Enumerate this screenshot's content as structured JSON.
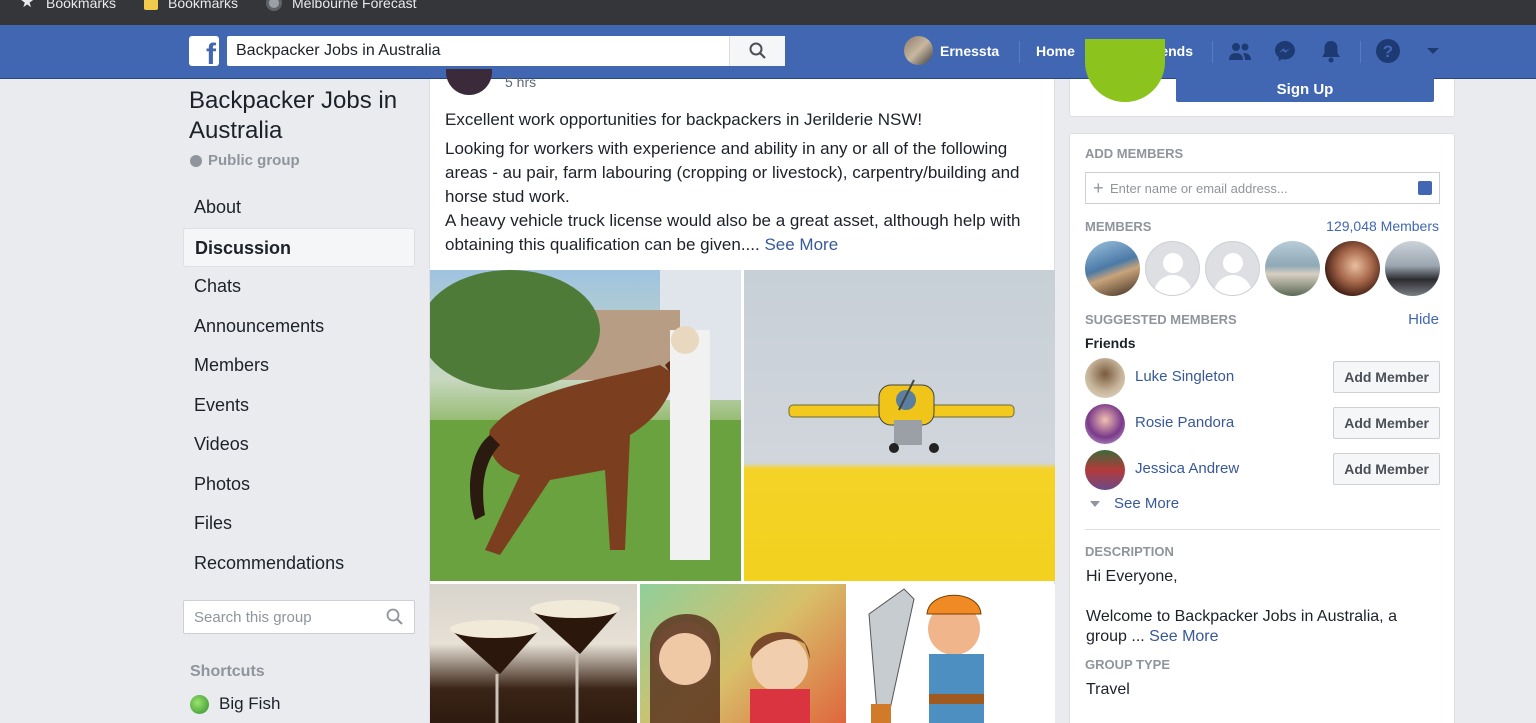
{
  "bookmarks_bar": {
    "items": [
      {
        "label": "Bookmarks",
        "icon": "star-icon"
      },
      {
        "label": "Bookmarks",
        "icon": "folder-icon"
      },
      {
        "label": "Melbourne Forecast",
        "icon": "gear-icon"
      }
    ]
  },
  "header": {
    "search_value": "Backpacker Jobs in Australia",
    "profile_name": "Ernessta",
    "home_label": "Home",
    "find_friends_label": "Find Friends"
  },
  "left": {
    "group_title": "Backpacker Jobs in Australia",
    "privacy": "Public group",
    "nav": [
      "About",
      "Discussion",
      "Chats",
      "Announcements",
      "Members",
      "Events",
      "Videos",
      "Photos",
      "Files",
      "Recommendations"
    ],
    "active_nav": "Discussion",
    "search_placeholder": "Search this group",
    "shortcuts_heading": "Shortcuts",
    "shortcut_item": "Big Fish"
  },
  "post": {
    "time": "5 hrs",
    "line1": "Excellent work opportunities for backpackers in Jerilderie NSW!",
    "body": "Looking for workers with experience and ability in any or all of the following areas - au pair, farm labouring (cropping or livestock), carpentry/building and horse stud work.",
    "body2": "A heavy vehicle truck license would also be a great asset, although help with obtaining this qualification can be given....",
    "see_more": "See More"
  },
  "right": {
    "signup_label": "Sign Up",
    "add_members_heading": "ADD MEMBERS",
    "add_members_placeholder": "Enter name or email address...",
    "members_heading": "MEMBERS",
    "members_count": "129,048 Members",
    "suggested_heading": "SUGGESTED MEMBERS",
    "hide_label": "Hide",
    "friends_label": "Friends",
    "suggested": [
      {
        "name": "Luke Singleton",
        "button": "Add Member"
      },
      {
        "name": "Rosie Pandora",
        "button": "Add Member"
      },
      {
        "name": "Jessica Andrew",
        "button": "Add Member"
      }
    ],
    "see_more": "See More",
    "description_heading": "DESCRIPTION",
    "description_line1": "Hi Everyone,",
    "description_line2": "Welcome to Backpacker Jobs in Australia, a group ...",
    "description_see_more": "See More",
    "group_type_heading": "GROUP TYPE",
    "group_type": "Travel"
  }
}
